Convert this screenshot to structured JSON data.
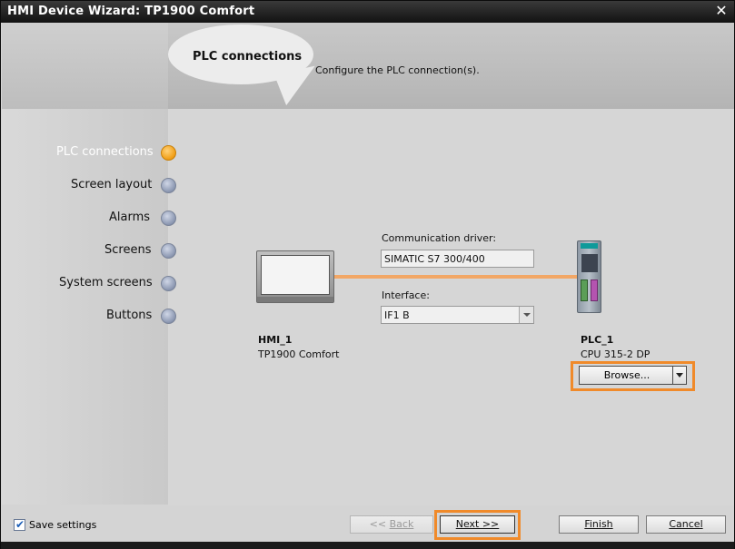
{
  "window": {
    "title": "HMI Device Wizard: TP1900 Comfort",
    "close_glyph": "✕"
  },
  "header": {
    "bubble_title": "PLC connections",
    "description": "Configure the PLC connection(s)."
  },
  "steps": [
    {
      "label": "PLC connections",
      "active": true
    },
    {
      "label": "Screen layout",
      "active": false
    },
    {
      "label": "Alarms",
      "active": false
    },
    {
      "label": "Screens",
      "active": false
    },
    {
      "label": "System screens",
      "active": false
    },
    {
      "label": "Buttons",
      "active": false
    }
  ],
  "connection": {
    "driver_label": "Communication driver:",
    "driver_value": "SIMATIC S7 300/400",
    "interface_label": "Interface:",
    "interface_value": "IF1 B"
  },
  "hmi": {
    "name": "HMI_1",
    "type": "TP1900 Comfort"
  },
  "plc": {
    "name": "PLC_1",
    "type": "CPU 315-2 DP",
    "browse_label": "Browse..."
  },
  "footer": {
    "save_settings_label": "Save settings",
    "save_settings_checked": true,
    "back_prefix": "<< ",
    "back_label": "Back",
    "next_label": "Next >>",
    "finish_label": "Finish",
    "cancel_label": "Cancel"
  },
  "colors": {
    "highlight": "#f08a2a",
    "active_step": "#f2a11b",
    "connection_line": "#f2a766"
  }
}
